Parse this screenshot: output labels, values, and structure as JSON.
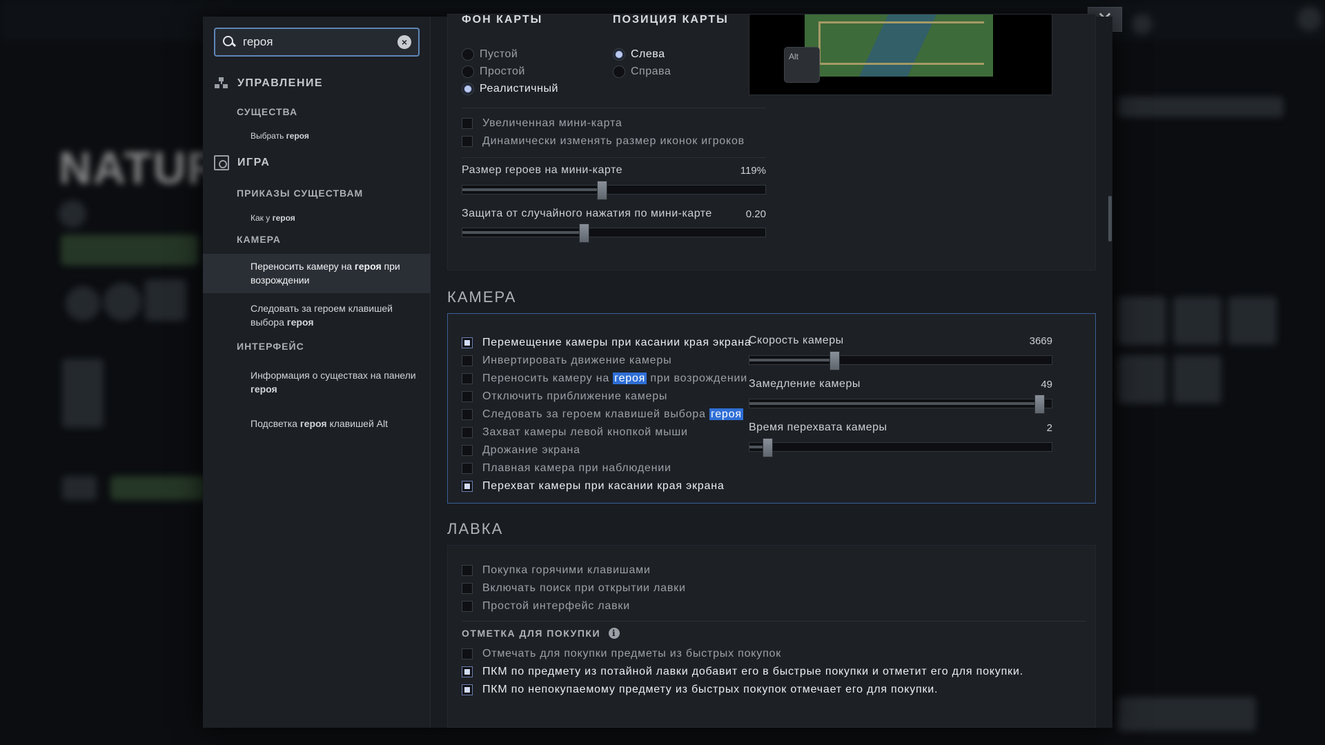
{
  "background": {
    "hero_name": "NATUR"
  },
  "search": {
    "value": "героя",
    "placeholder": "",
    "clear_symbol": "⊗"
  },
  "sidebar": {
    "categories": [
      {
        "label": "УПРАВЛЕНИЕ",
        "icon": "controls-icon"
      },
      {
        "label": "ИГРА",
        "icon": "game-icon"
      }
    ],
    "control_sub": "СУЩЕСТВА",
    "control_items": [
      {
        "pre": "Выбрать ",
        "bold": "героя",
        "post": ""
      }
    ],
    "game_subs": [
      "ПРИКАЗЫ СУЩЕСТВАМ",
      "КАМЕРА",
      "ИНТЕРФЕЙС"
    ],
    "orders_items": [
      {
        "pre": "Как у ",
        "bold": "героя",
        "post": ""
      }
    ],
    "camera_items": [
      {
        "pre": "Переносить камеру на ",
        "bold": "героя",
        "post": " при возрождении",
        "active": true
      },
      {
        "pre": "Следовать за героем клавишей выбора ",
        "bold": "героя",
        "post": ""
      }
    ],
    "interface_items": [
      {
        "pre": "Информация о существах на панели ",
        "bold": "героя",
        "post": ""
      },
      {
        "pre": "Подсветка ",
        "bold": "героя",
        "post": " клавишей Alt"
      }
    ]
  },
  "minimap": {
    "background_title": "ФОН КАРТЫ",
    "background_options": [
      {
        "label": "Пустой",
        "selected": false
      },
      {
        "label": "Простой",
        "selected": false
      },
      {
        "label": "Реалистичный",
        "selected": true
      }
    ],
    "position_title": "ПОЗИЦИЯ КАРТЫ",
    "position_options": [
      {
        "label": "Слева",
        "selected": true
      },
      {
        "label": "Справа",
        "selected": false
      }
    ],
    "checkboxes": [
      {
        "label": "Увеличенная мини-карта",
        "checked": false
      },
      {
        "label": "Динамически изменять размер иконок игроков",
        "checked": false
      }
    ],
    "sliders": [
      {
        "label": "Размер героев на мини-карте",
        "value": "119%",
        "fraction": 0.46
      },
      {
        "label": "Защита от случайного нажатия по мини-карте",
        "value": "0.20",
        "fraction": 0.4
      }
    ],
    "preview_key": "Alt"
  },
  "camera": {
    "title": "КАМЕРА",
    "checkboxes": [
      {
        "label": "Перемещение камеры при касании края экрана",
        "checked": true
      },
      {
        "label": "Инвертировать движение камеры",
        "checked": false
      },
      {
        "label": "Переносить камеру на ",
        "hl": "героя",
        "post": " при возрождении",
        "checked": false
      },
      {
        "label": "Отключить приближение камеры",
        "checked": false
      },
      {
        "label": "Следовать за героем клавишей выбора ",
        "hl": "героя",
        "post": "",
        "checked": false
      },
      {
        "label": "Захват камеры левой кнопкой мыши",
        "checked": false
      },
      {
        "label": "Дрожание экрана",
        "checked": false
      },
      {
        "label": "Плавная камера при наблюдении",
        "checked": false
      },
      {
        "label": "Перехват камеры при касании края экрана",
        "checked": true
      }
    ],
    "sliders": [
      {
        "label": "Скорость камеры",
        "value": "3669",
        "fraction": 0.28
      },
      {
        "label": "Замедление камеры",
        "value": "49",
        "fraction": 0.96
      },
      {
        "label": "Время перехвата камеры",
        "value": "2",
        "fraction": 0.06
      }
    ]
  },
  "shop": {
    "title": "ЛАВКА",
    "checkboxes": [
      {
        "label": "Покупка горячими клавишами",
        "checked": false
      },
      {
        "label": "Включать поиск при открытии лавки",
        "checked": false
      },
      {
        "label": "Простой интерфейс лавки",
        "checked": false
      }
    ],
    "purchase_caption": "ОТМЕТКА ДЛЯ ПОКУПКИ",
    "info_symbol": "i",
    "purchase_checkboxes": [
      {
        "label": "Отмечать для покупки предметы из быстрых покупок",
        "checked": false
      },
      {
        "label": "ПКМ по предмету из потайной лавки добавит его в быстрые покупки и отметит его для покупки.",
        "checked": true
      },
      {
        "label": "ПКМ по непокупаемому предмету из быстрых покупок отмечает его для покупки.",
        "checked": true
      }
    ]
  },
  "close_symbol": "✕",
  "colors": {
    "accent_highlight": "#2f6fd6",
    "search_border": "#5f86b8",
    "panel": "#191c21"
  }
}
